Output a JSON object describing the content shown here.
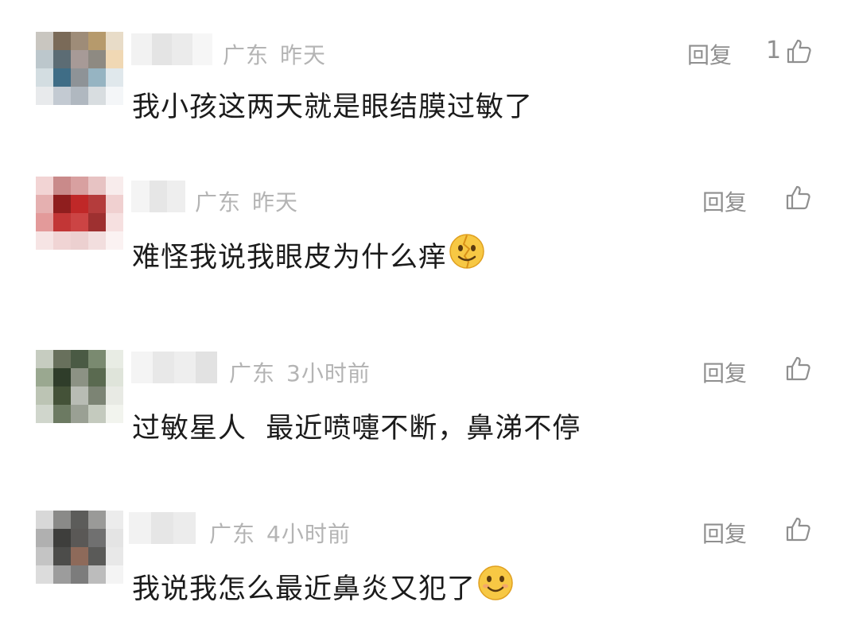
{
  "comments": [
    {
      "location": "广东",
      "time": "昨天",
      "reply_label": "回复",
      "like_count": "1",
      "text": "我小孩这两天就是眼结膜过敏了",
      "emoji": "",
      "avatar_icon": "pixelated-avatar",
      "avatar_colors": [
        "#c9c6c0",
        "#7a6a58",
        "#9e8c78",
        "#b69a6c",
        "#e8dcc8",
        "#bcc7cc",
        "#5c6c74",
        "#a79a97",
        "#8e8a82",
        "#f0d8b4",
        "#d3dde1",
        "#3f6d86",
        "#8e9397",
        "#96b4c2",
        "#e0e8ec",
        "#e8eaec",
        "#c3cad2",
        "#b0b8c0",
        "#d8dde0",
        "#f4f6f8"
      ]
    },
    {
      "location": "广东",
      "time": "昨天",
      "reply_label": "回复",
      "like_count": "",
      "text": "难怪我说我眼皮为什么痒",
      "emoji": "cracked-face-emoji",
      "avatar_icon": "pixelated-avatar",
      "avatar_colors": [
        "#f2d4d4",
        "#c98a8a",
        "#d8a0a0",
        "#e7c3c3",
        "#f8ecec",
        "#e5b0b0",
        "#8f1e1e",
        "#c02828",
        "#b43c3c",
        "#f0d0d0",
        "#e39a9a",
        "#c23636",
        "#cc4444",
        "#9e3030",
        "#f6e0e0",
        "#f6e4e4",
        "#f0d4d4",
        "#ecd0d0",
        "#f2dede",
        "#fbf2f2"
      ]
    },
    {
      "location": "广东",
      "time": "3小时前",
      "reply_label": "回复",
      "like_count": "",
      "text": "过敏星人  最近喷嚏不断，鼻涕不停",
      "emoji": "",
      "avatar_icon": "pixelated-avatar",
      "avatar_colors": [
        "#c6ccc0",
        "#68705c",
        "#4a5a44",
        "#7a8a70",
        "#e8ece4",
        "#9aa890",
        "#2f3d2a",
        "#8c9284",
        "#5a6a50",
        "#dfe4da",
        "#bcc4b4",
        "#445238",
        "#b8bcb4",
        "#7c8474",
        "#e8eae4",
        "#d0d6cc",
        "#6c7a62",
        "#9aa094",
        "#c4cabe",
        "#f2f4ee"
      ]
    },
    {
      "location": "广东",
      "time": "4小时前",
      "reply_label": "回复",
      "like_count": "",
      "text": "我说我怎么最近鼻炎又犯了",
      "emoji": "smile-emoji",
      "avatar_icon": "pixelated-avatar",
      "avatar_colors": [
        "#d8d8d8",
        "#8a8a88",
        "#5c5c5a",
        "#9a9a98",
        "#ececec",
        "#b0b0b0",
        "#3e3e3c",
        "#5a5856",
        "#707070",
        "#e4e4e4",
        "#c4c4c4",
        "#4c4c4a",
        "#8e6a5a",
        "#5a5a58",
        "#e8e8e8",
        "#dcdcdc",
        "#9c9c9c",
        "#7c7c7c",
        "#bcbcbc",
        "#f4f4f4"
      ]
    }
  ]
}
